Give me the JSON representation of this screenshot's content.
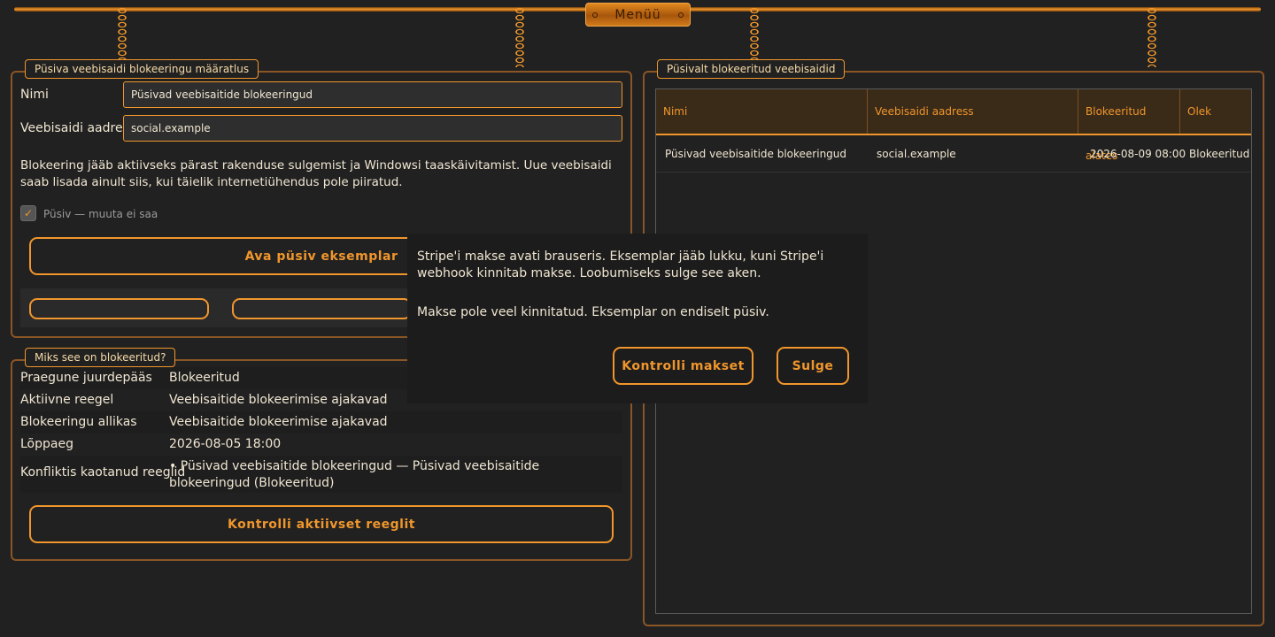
{
  "menu": {
    "label": "Menüü"
  },
  "definition": {
    "legend": "Püsiva veebisaidi blokeeringu määratlus",
    "name_label": "Nimi",
    "name_value": "Püsivad veebisaitide blokeeringud",
    "address_label": "Veebisaidi aadress",
    "address_value": "social.example",
    "description": "Blokeering jääb aktiivseks pärast rakenduse sulgemist ja Windowsi taaskäivitamist. Uue veebisaidi saab lisada ainult siis, kui täielik internetiühendus pole piiratud.",
    "checkbox_label": "Püsiv — muuta ei saa",
    "checkbox_checked": true,
    "open_button": "Ava püsiv eksemplar"
  },
  "why": {
    "legend": "Miks see on blokeeritud?",
    "rows": [
      {
        "key": "Praegune juurdepääs",
        "value": "Blokeeritud"
      },
      {
        "key": "Aktiivne reegel",
        "value": "Veebisaitide blokeerimise ajakavad"
      },
      {
        "key": "Blokeeringu allikas",
        "value": "Veebisaitide blokeerimise ajakavad"
      },
      {
        "key": "Lõppaeg",
        "value": "2026-08-05 18:00"
      },
      {
        "key": "Konfliktis kaotanud reeglid",
        "value": "• Püsivad veebisaitide blokeeringud — Püsivad veebisaitide blokeeringud (Blokeeritud)"
      }
    ],
    "check_button": "Kontrolli aktiivset reeglit"
  },
  "blocked": {
    "legend": "Püsivalt blokeeritud veebisaidid",
    "columns": [
      "Nimi",
      "Veebisaidi aadress",
      "Blokeeritud alates",
      "Olek"
    ],
    "rows": [
      [
        "Püsivad veebisaitide blokeeringud",
        "social.example",
        "2026-08-09 08:00",
        "Blokeeritud"
      ]
    ]
  },
  "dialog": {
    "message": "Stripe'i makse avati brauseris. Eksemplar jääb lukku, kuni Stripe'i webhook kinnitab makse. Loobumiseks sulge see aken.",
    "status": "Makse pole veel kinnitatud. Eksemplar on endiselt püsiv.",
    "check_payment_button": "Kontrolli makset",
    "close_button": "Sulge"
  },
  "colors": {
    "accent": "#f0962c",
    "background": "#212121",
    "text": "#f0e6d2"
  }
}
